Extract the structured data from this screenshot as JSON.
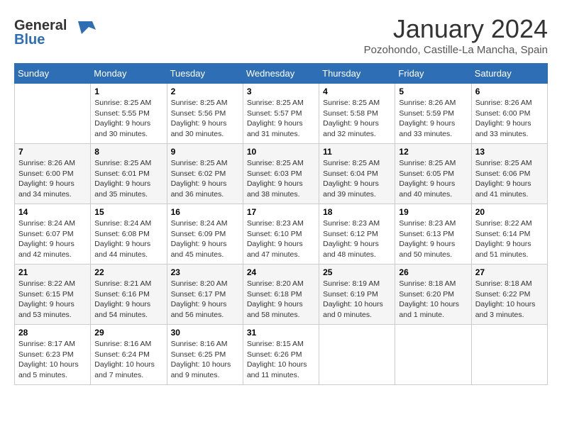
{
  "header": {
    "logo_general": "General",
    "logo_blue": "Blue",
    "title": "January 2024",
    "location": "Pozohondo, Castille-La Mancha, Spain"
  },
  "days_of_week": [
    "Sunday",
    "Monday",
    "Tuesday",
    "Wednesday",
    "Thursday",
    "Friday",
    "Saturday"
  ],
  "weeks": [
    [
      {
        "day": "",
        "sunrise": "",
        "sunset": "",
        "daylight": ""
      },
      {
        "day": "1",
        "sunrise": "Sunrise: 8:25 AM",
        "sunset": "Sunset: 5:55 PM",
        "daylight": "Daylight: 9 hours and 30 minutes."
      },
      {
        "day": "2",
        "sunrise": "Sunrise: 8:25 AM",
        "sunset": "Sunset: 5:56 PM",
        "daylight": "Daylight: 9 hours and 30 minutes."
      },
      {
        "day": "3",
        "sunrise": "Sunrise: 8:25 AM",
        "sunset": "Sunset: 5:57 PM",
        "daylight": "Daylight: 9 hours and 31 minutes."
      },
      {
        "day": "4",
        "sunrise": "Sunrise: 8:25 AM",
        "sunset": "Sunset: 5:58 PM",
        "daylight": "Daylight: 9 hours and 32 minutes."
      },
      {
        "day": "5",
        "sunrise": "Sunrise: 8:26 AM",
        "sunset": "Sunset: 5:59 PM",
        "daylight": "Daylight: 9 hours and 33 minutes."
      },
      {
        "day": "6",
        "sunrise": "Sunrise: 8:26 AM",
        "sunset": "Sunset: 6:00 PM",
        "daylight": "Daylight: 9 hours and 33 minutes."
      }
    ],
    [
      {
        "day": "7",
        "sunrise": "Sunrise: 8:26 AM",
        "sunset": "Sunset: 6:00 PM",
        "daylight": "Daylight: 9 hours and 34 minutes."
      },
      {
        "day": "8",
        "sunrise": "Sunrise: 8:25 AM",
        "sunset": "Sunset: 6:01 PM",
        "daylight": "Daylight: 9 hours and 35 minutes."
      },
      {
        "day": "9",
        "sunrise": "Sunrise: 8:25 AM",
        "sunset": "Sunset: 6:02 PM",
        "daylight": "Daylight: 9 hours and 36 minutes."
      },
      {
        "day": "10",
        "sunrise": "Sunrise: 8:25 AM",
        "sunset": "Sunset: 6:03 PM",
        "daylight": "Daylight: 9 hours and 38 minutes."
      },
      {
        "day": "11",
        "sunrise": "Sunrise: 8:25 AM",
        "sunset": "Sunset: 6:04 PM",
        "daylight": "Daylight: 9 hours and 39 minutes."
      },
      {
        "day": "12",
        "sunrise": "Sunrise: 8:25 AM",
        "sunset": "Sunset: 6:05 PM",
        "daylight": "Daylight: 9 hours and 40 minutes."
      },
      {
        "day": "13",
        "sunrise": "Sunrise: 8:25 AM",
        "sunset": "Sunset: 6:06 PM",
        "daylight": "Daylight: 9 hours and 41 minutes."
      }
    ],
    [
      {
        "day": "14",
        "sunrise": "Sunrise: 8:24 AM",
        "sunset": "Sunset: 6:07 PM",
        "daylight": "Daylight: 9 hours and 42 minutes."
      },
      {
        "day": "15",
        "sunrise": "Sunrise: 8:24 AM",
        "sunset": "Sunset: 6:08 PM",
        "daylight": "Daylight: 9 hours and 44 minutes."
      },
      {
        "day": "16",
        "sunrise": "Sunrise: 8:24 AM",
        "sunset": "Sunset: 6:09 PM",
        "daylight": "Daylight: 9 hours and 45 minutes."
      },
      {
        "day": "17",
        "sunrise": "Sunrise: 8:23 AM",
        "sunset": "Sunset: 6:10 PM",
        "daylight": "Daylight: 9 hours and 47 minutes."
      },
      {
        "day": "18",
        "sunrise": "Sunrise: 8:23 AM",
        "sunset": "Sunset: 6:12 PM",
        "daylight": "Daylight: 9 hours and 48 minutes."
      },
      {
        "day": "19",
        "sunrise": "Sunrise: 8:23 AM",
        "sunset": "Sunset: 6:13 PM",
        "daylight": "Daylight: 9 hours and 50 minutes."
      },
      {
        "day": "20",
        "sunrise": "Sunrise: 8:22 AM",
        "sunset": "Sunset: 6:14 PM",
        "daylight": "Daylight: 9 hours and 51 minutes."
      }
    ],
    [
      {
        "day": "21",
        "sunrise": "Sunrise: 8:22 AM",
        "sunset": "Sunset: 6:15 PM",
        "daylight": "Daylight: 9 hours and 53 minutes."
      },
      {
        "day": "22",
        "sunrise": "Sunrise: 8:21 AM",
        "sunset": "Sunset: 6:16 PM",
        "daylight": "Daylight: 9 hours and 54 minutes."
      },
      {
        "day": "23",
        "sunrise": "Sunrise: 8:20 AM",
        "sunset": "Sunset: 6:17 PM",
        "daylight": "Daylight: 9 hours and 56 minutes."
      },
      {
        "day": "24",
        "sunrise": "Sunrise: 8:20 AM",
        "sunset": "Sunset: 6:18 PM",
        "daylight": "Daylight: 9 hours and 58 minutes."
      },
      {
        "day": "25",
        "sunrise": "Sunrise: 8:19 AM",
        "sunset": "Sunset: 6:19 PM",
        "daylight": "Daylight: 10 hours and 0 minutes."
      },
      {
        "day": "26",
        "sunrise": "Sunrise: 8:18 AM",
        "sunset": "Sunset: 6:20 PM",
        "daylight": "Daylight: 10 hours and 1 minute."
      },
      {
        "day": "27",
        "sunrise": "Sunrise: 8:18 AM",
        "sunset": "Sunset: 6:22 PM",
        "daylight": "Daylight: 10 hours and 3 minutes."
      }
    ],
    [
      {
        "day": "28",
        "sunrise": "Sunrise: 8:17 AM",
        "sunset": "Sunset: 6:23 PM",
        "daylight": "Daylight: 10 hours and 5 minutes."
      },
      {
        "day": "29",
        "sunrise": "Sunrise: 8:16 AM",
        "sunset": "Sunset: 6:24 PM",
        "daylight": "Daylight: 10 hours and 7 minutes."
      },
      {
        "day": "30",
        "sunrise": "Sunrise: 8:16 AM",
        "sunset": "Sunset: 6:25 PM",
        "daylight": "Daylight: 10 hours and 9 minutes."
      },
      {
        "day": "31",
        "sunrise": "Sunrise: 8:15 AM",
        "sunset": "Sunset: 6:26 PM",
        "daylight": "Daylight: 10 hours and 11 minutes."
      },
      {
        "day": "",
        "sunrise": "",
        "sunset": "",
        "daylight": ""
      },
      {
        "day": "",
        "sunrise": "",
        "sunset": "",
        "daylight": ""
      },
      {
        "day": "",
        "sunrise": "",
        "sunset": "",
        "daylight": ""
      }
    ]
  ]
}
